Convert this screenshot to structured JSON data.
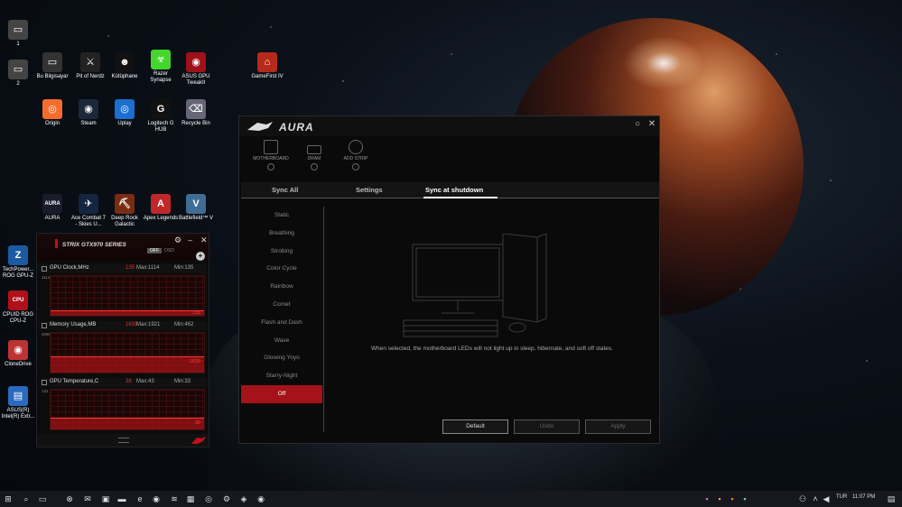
{
  "desktop": {
    "icons": [
      {
        "label": "1",
        "glyph": "▭",
        "color": "#444"
      },
      {
        "label": "2",
        "glyph": "▭",
        "color": "#444"
      },
      {
        "label": "Bu Bilgisayar",
        "glyph": "▭",
        "color": "#333"
      },
      {
        "label": "Pit of Nerdz",
        "glyph": "⚔",
        "color": "#222"
      },
      {
        "label": "Kütüphane",
        "glyph": "☻",
        "color": "#111"
      },
      {
        "label": "Razer Synapse",
        "glyph": "☣",
        "color": "#44d62c"
      },
      {
        "label": "ASUS GPU TweakII",
        "glyph": "◉",
        "color": "#a0101a"
      },
      {
        "label": "GameFirst IV",
        "glyph": "⌂",
        "color": "#b52a1a"
      },
      {
        "label": "Origin",
        "glyph": "◎",
        "color": "#f56c2d"
      },
      {
        "label": "Steam",
        "glyph": "◉",
        "color": "#1b2838"
      },
      {
        "label": "Uplay",
        "glyph": "◎",
        "color": "#1a6fd1"
      },
      {
        "label": "Logitech G HUB",
        "glyph": "G",
        "color": "#111"
      },
      {
        "label": "Recycle Bin",
        "glyph": "⌫",
        "color": "#667"
      },
      {
        "label": "AURA",
        "glyph": "AURA",
        "color": "#1a1a2a"
      },
      {
        "label": "Ace Combat 7 - Skies U...",
        "glyph": "✈",
        "color": "#152440"
      },
      {
        "label": "Deep Rock Galactic",
        "glyph": "⛏",
        "color": "#7a2c12"
      },
      {
        "label": "Apex Legends",
        "glyph": "A",
        "color": "#c0282a"
      },
      {
        "label": "Battlefield™ V",
        "glyph": "V",
        "color": "#3f6d94"
      },
      {
        "label": "TechPower... ROG GPU-Z",
        "glyph": "Z",
        "color": "#1a5aa0"
      },
      {
        "label": "CPUID ROG CPU-Z",
        "glyph": "CPU",
        "color": "#b0101a"
      },
      {
        "label": "CloneDrive",
        "glyph": "◉",
        "color": "#b33"
      },
      {
        "label": "ASUS(R) Intel(R) Extr...",
        "glyph": "▤",
        "color": "#2a6bbf"
      }
    ]
  },
  "aura": {
    "title": "AURA",
    "devices": [
      "MOTHERBOARD",
      "DRAM",
      "ADD STRIP"
    ],
    "tabs": [
      "Sync All",
      "Settings",
      "Sync at shutdown"
    ],
    "active_tab": "Sync at shutdown",
    "effects": [
      "Static",
      "Breathing",
      "Strobing",
      "Color Cycle",
      "Rainbow",
      "Comet",
      "Flash and Dash",
      "Wave",
      "Glowing Yoyo",
      "Starry-Night",
      "Off"
    ],
    "selected_effect": "Off",
    "description": "When selected, the motherboard LEDs will not light up in sleep, hibernate, and soft off states.",
    "buttons": {
      "default": "Default",
      "undo": "Undo",
      "apply": "Apply"
    },
    "accent": "#a5121a"
  },
  "gpu_monitor": {
    "title": "STRIX GTX970 SERIES",
    "toggle": {
      "off": "OFF",
      "osd": "OSD"
    },
    "graphs": [
      {
        "name": "GPU Clock,MHz",
        "current": "135",
        "max": "Max:1114",
        "min": "Min:135",
        "scale_max": "1114",
        "level": 0.12
      },
      {
        "name": "Memory Usage,MB",
        "current": "1639",
        "max": "Max:1921",
        "min": "Min:462",
        "scale_max": "4096",
        "level": 0.4
      },
      {
        "name": "GPU Temperature,C",
        "current": "38",
        "max": "Max:43",
        "min": "Min:33",
        "scale_max": "131",
        "level": 0.29
      }
    ]
  },
  "taskbar": {
    "language": "TUR",
    "time": "11:07 PM"
  }
}
